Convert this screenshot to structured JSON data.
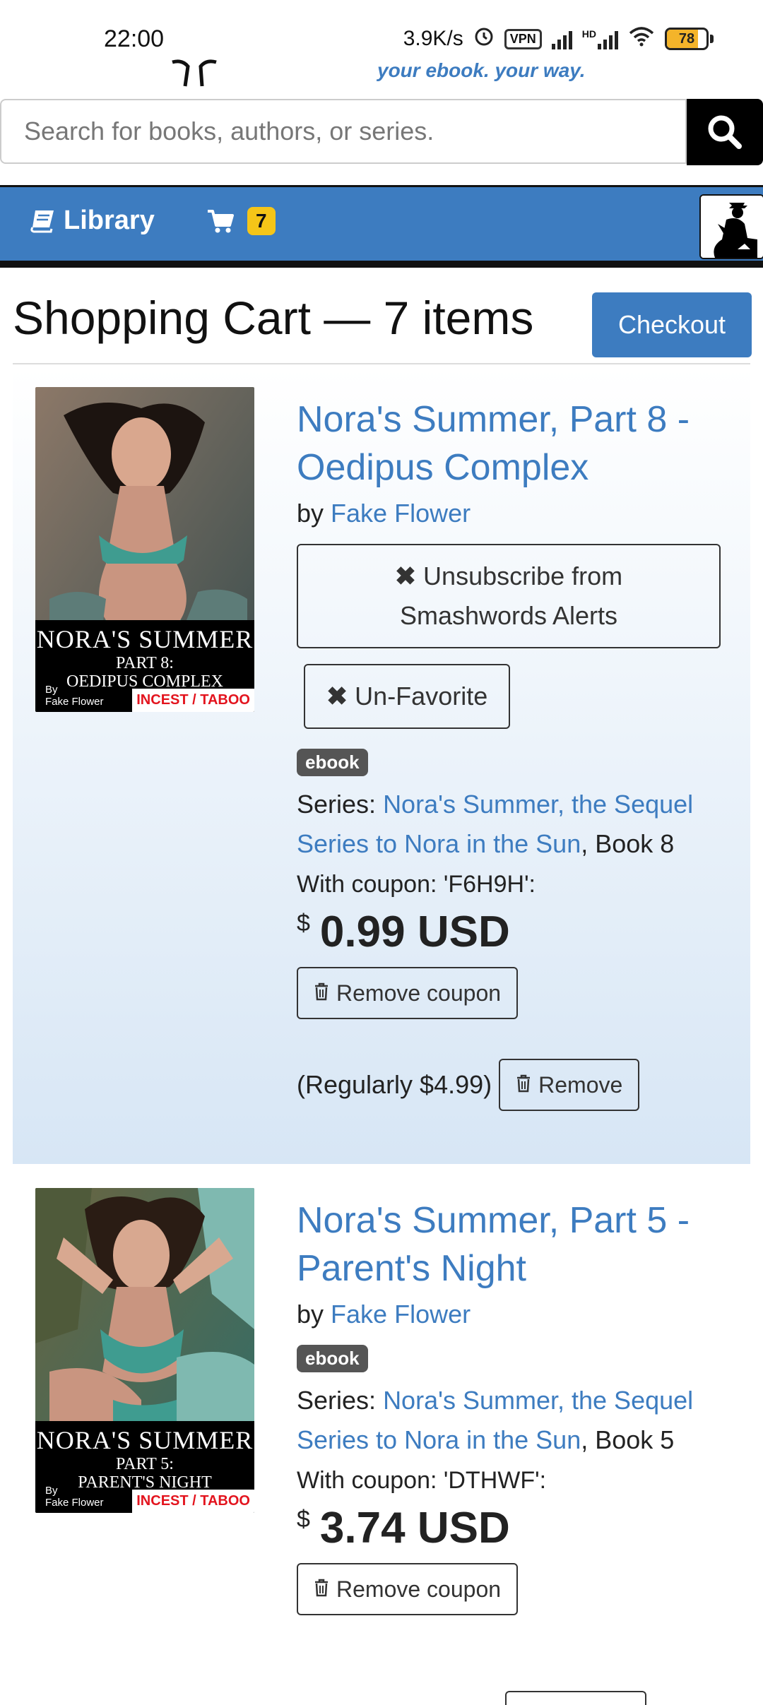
{
  "status_bar": {
    "time": "22:00",
    "net_speed": "3.9K/s",
    "vpn": "VPN",
    "hd": "HD",
    "battery": "78",
    "battery_fill": 0.78
  },
  "header": {
    "tagline": "your ebook. your way.",
    "search_placeholder": "Search for books, authors, or series."
  },
  "navbar": {
    "library_label": "Library",
    "cart_count": "7",
    "brand_color": "#3d7cc0"
  },
  "page": {
    "title": "Shopping Cart — 7 items",
    "checkout_label": "Checkout"
  },
  "items": [
    {
      "title": "Nora's Summer, Part 8 - Oedipus Complex",
      "by": "by",
      "author": "Fake Flower",
      "unsubscribe_label": "Unsubscribe from Smashwords Alerts",
      "unfavorite_label": "Un-Favorite",
      "format": "ebook",
      "series_prefix": "Series:",
      "series_name": "Nora's Summer, the Sequel Series to Nora in the Sun",
      "series_suffix": ", Book 8",
      "coupon_text": "With coupon: 'F6H9H':",
      "currency": "$",
      "price": "0.99 USD",
      "remove_coupon_label": "Remove coupon",
      "regular_price": "(Regularly $4.99)",
      "remove_label": "Remove",
      "cover": {
        "title": "NORA'S SUMMER",
        "part": "PART 8:",
        "subtitle": "OEDIPUS COMPLEX",
        "by": "By",
        "author": "Fake Flower",
        "tag": "INCEST / TABOO"
      }
    },
    {
      "title": "Nora's Summer, Part 5 - Parent's Night",
      "by": "by",
      "author": "Fake Flower",
      "format": "ebook",
      "series_prefix": "Series:",
      "series_name": "Nora's Summer, the Sequel Series to Nora in the Sun",
      "series_suffix": ", Book 5",
      "coupon_text": "With coupon: 'DTHWF':",
      "currency": "$",
      "price": "3.74 USD",
      "remove_coupon_label": "Remove coupon",
      "cover": {
        "title": "NORA'S SUMMER",
        "part": "PART 5:",
        "subtitle": "PARENT'S NIGHT",
        "by": "By",
        "author": "Fake Flower",
        "tag": "INCEST / TABOO"
      }
    }
  ]
}
